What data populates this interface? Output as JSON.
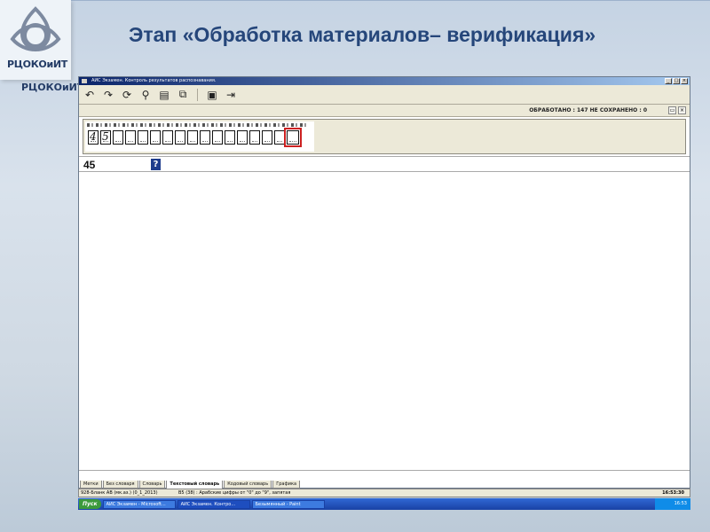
{
  "slide": {
    "logo_text": "РЦОКОиИТ",
    "logo_text_2": "РЦОКОиИТ",
    "title": "Этап «Обработка материалов– верификация»"
  },
  "window": {
    "title": "АИС Экзамен. Контроль результатов распознавания."
  },
  "toolbar": {
    "icons": [
      "undo-icon",
      "redo-icon",
      "refresh-icon",
      "search-icon",
      "paste-icon",
      "copy-icon",
      "save-icon",
      "export-icon"
    ]
  },
  "status": {
    "info": "ОБРАБОТАНО : 147   НЕ СОХРАНЕНО : 0"
  },
  "image": {
    "handwriting_1": "4",
    "handwriting_2": "5"
  },
  "field": {
    "value": "45",
    "unknown_mark": "?"
  },
  "tabs": [
    {
      "label": "Метки"
    },
    {
      "label": "Без словаря"
    },
    {
      "label": "Словарь"
    },
    {
      "label": "Текстовый словарь"
    },
    {
      "label": "Кодовый словарь"
    },
    {
      "label": "Графика"
    }
  ],
  "info_strip": {
    "left": "928-Бланк АВ (мк.аз.) (0_1_2013)",
    "middle": "B5 (38) : Арабские цифры от \"0\" до \"9\", запятая",
    "time": "16:53:30"
  },
  "taskbar": {
    "start": "Пуск",
    "tasks": [
      {
        "label": "АИС Экзамен - Microsoft..."
      },
      {
        "label": "АИС Экзамен. Контро..."
      },
      {
        "label": "Безымянный - Paint"
      }
    ],
    "clock": "16:53"
  },
  "colors": {
    "title": "#25467a",
    "selection": "#cc2020",
    "unknown_mark_bg": "#1e3c8c"
  }
}
